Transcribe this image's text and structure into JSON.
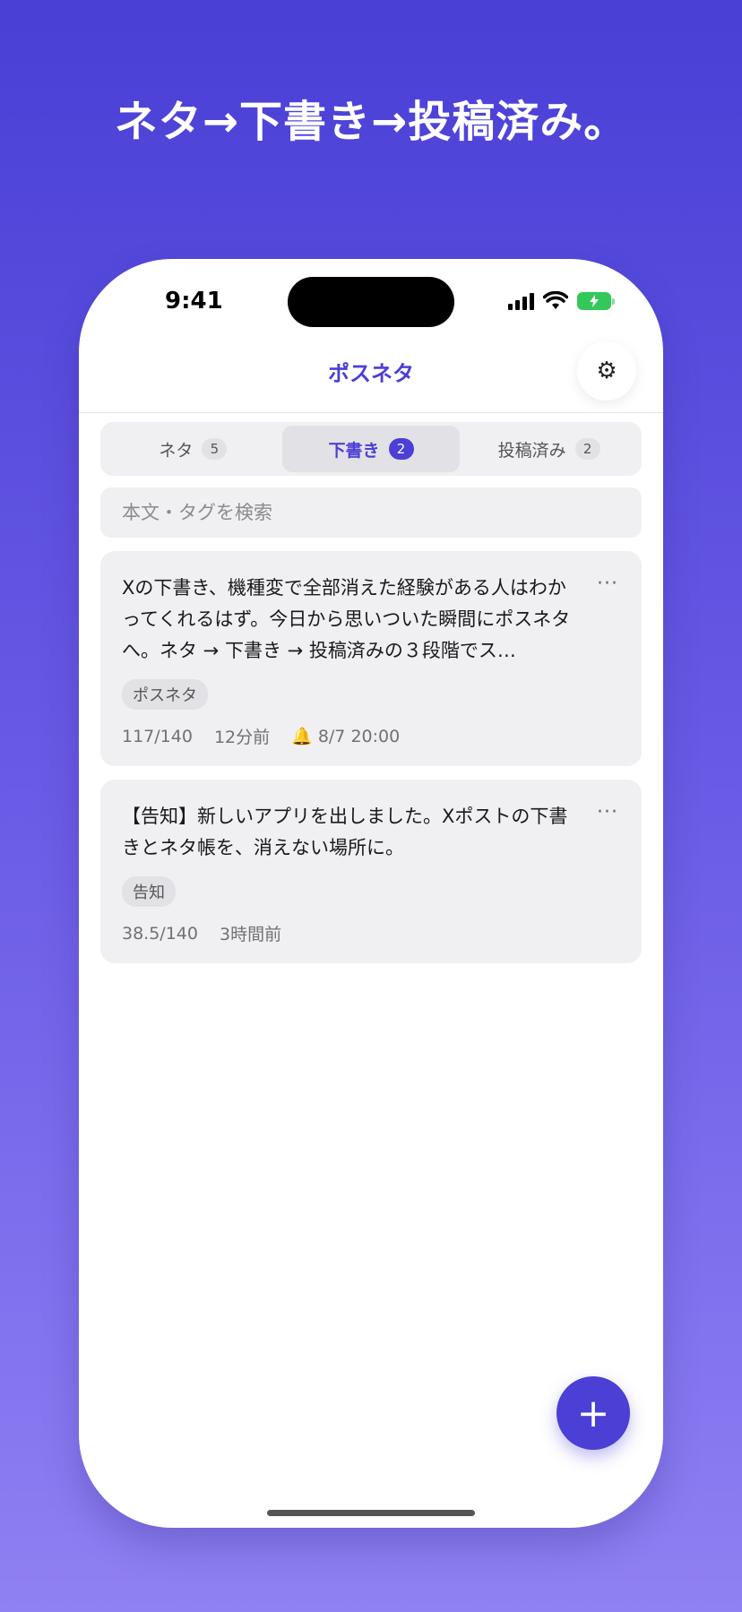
{
  "headline": "ネタ→下書き→投稿済み。",
  "status_bar": {
    "time": "9:41",
    "icons": [
      "signal-icon",
      "wifi-icon",
      "battery-charging-icon"
    ]
  },
  "nav": {
    "title": "ポスネタ",
    "settings_icon": "gear-icon"
  },
  "tabs": [
    {
      "label": "ネタ",
      "count": "5",
      "active": false
    },
    {
      "label": "下書き",
      "count": "2",
      "active": true
    },
    {
      "label": "投稿済み",
      "count": "2",
      "active": false
    }
  ],
  "search": {
    "placeholder": "本文・タグを検索",
    "value": ""
  },
  "cards": [
    {
      "text": "Xの下書き、機種変で全部消えた経験がある人はわかってくれるはず。今日から思いついた瞬間にポスネタへ。ネタ → 下書き → 投稿済みの３段階でス…",
      "more": "···",
      "tag": "ポスネタ",
      "count": "117/140",
      "time": "12分前",
      "reminder": "🔔 8/7 20:00"
    },
    {
      "text": "【告知】新しいアプリを出しました。Xポストの下書きとネタ帳を、消えない場所に。",
      "more": "···",
      "tag": "告知",
      "count": "38.5/140",
      "time": "3時間前"
    }
  ],
  "fab": {
    "label": "+"
  },
  "colors": {
    "accent": "#4b3fd6",
    "background_top": "#4a3fd6",
    "background_bottom": "#8f80f3",
    "card": "#f0f0f3"
  }
}
